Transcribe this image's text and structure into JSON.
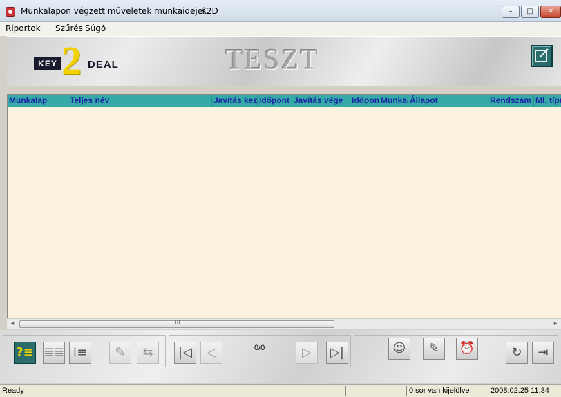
{
  "window": {
    "title": "Munkalapon végzett műveletek munkaidejei",
    "app_name": "K2D",
    "controls": [
      "–",
      "□",
      "✕"
    ]
  },
  "menu": [
    "Riportok",
    "Szűrés",
    "Súgó"
  ],
  "banner": {
    "logo_key": "KEY",
    "logo_2": "2",
    "logo_deal": "DEAL",
    "title": "TESZT"
  },
  "grid": {
    "columns": [
      "Munkalap",
      "Teljes név",
      "Javítás kezdete",
      "Időpont",
      "Javítás vége",
      "Időpont",
      "Munkaidő",
      "Állapot",
      "Rendszám",
      "Ml. típus"
    ],
    "rows": [],
    "header_color": "#35aaa8",
    "header_text_color": "#1c26a3",
    "background": "#fcf2df"
  },
  "scrollbar": {
    "grip": "III",
    "left": "◂",
    "right": "▸"
  },
  "toolbar": {
    "record_counter": "0/0",
    "icons": {
      "view_detail": "?≡",
      "view_list": "≣≣",
      "view_tree": "⁞≡",
      "tool_a": "✎",
      "tool_b": "⇆",
      "first": "|◁",
      "prev": "◁",
      "next": "▷",
      "last": "▷|",
      "user": "☺",
      "note": "✎",
      "alarm": "⏰",
      "refresh": "↻",
      "exit": "⇥"
    }
  },
  "status": {
    "message": "Ready",
    "selection": "0 sor van kijelölve",
    "datetime": "2008.02.25 11:34"
  }
}
